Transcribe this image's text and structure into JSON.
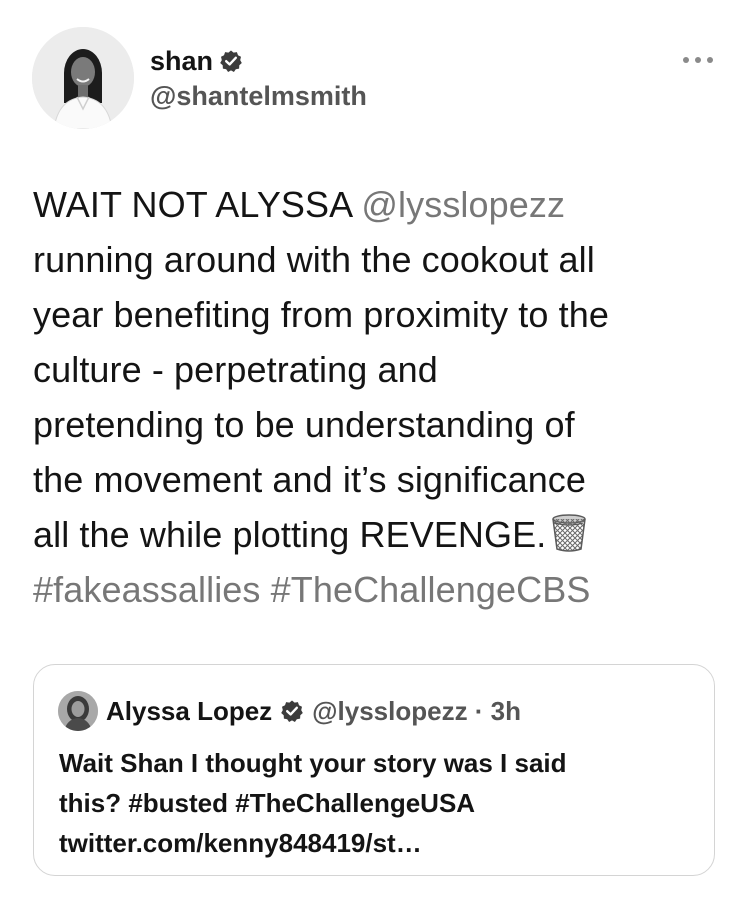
{
  "author": {
    "display_name": "shan",
    "handle": "@shantelmsmith",
    "verified": true
  },
  "tweet": {
    "line1_text": "WAIT NOT ALYSSA ",
    "line1_mention": "@lysslopezz",
    "line2": "running around with the cookout all",
    "line3": "year benefiting from proximity to the",
    "line4": "culture - perpetrating and",
    "line5": "pretending to be understanding of",
    "line6": "the movement and it’s significance",
    "line7": "all the while plotting REVENGE.",
    "emoji": "wastebasket-icon",
    "hashtags": "#fakeassallies #TheChallengeCBS"
  },
  "quoted": {
    "display_name": "Alyssa Lopez",
    "handle_time": "@lysslopezz · 3h",
    "text_line1": "Wait Shan I thought your story was I said",
    "text_line2": "this? #busted #TheChallengeUSA",
    "text_line3": "twitter.com/kenny848419/st…"
  },
  "colors": {
    "text": "#141414",
    "secondary": "#555555",
    "link_gray": "#777777",
    "border": "#d4d4d4"
  }
}
